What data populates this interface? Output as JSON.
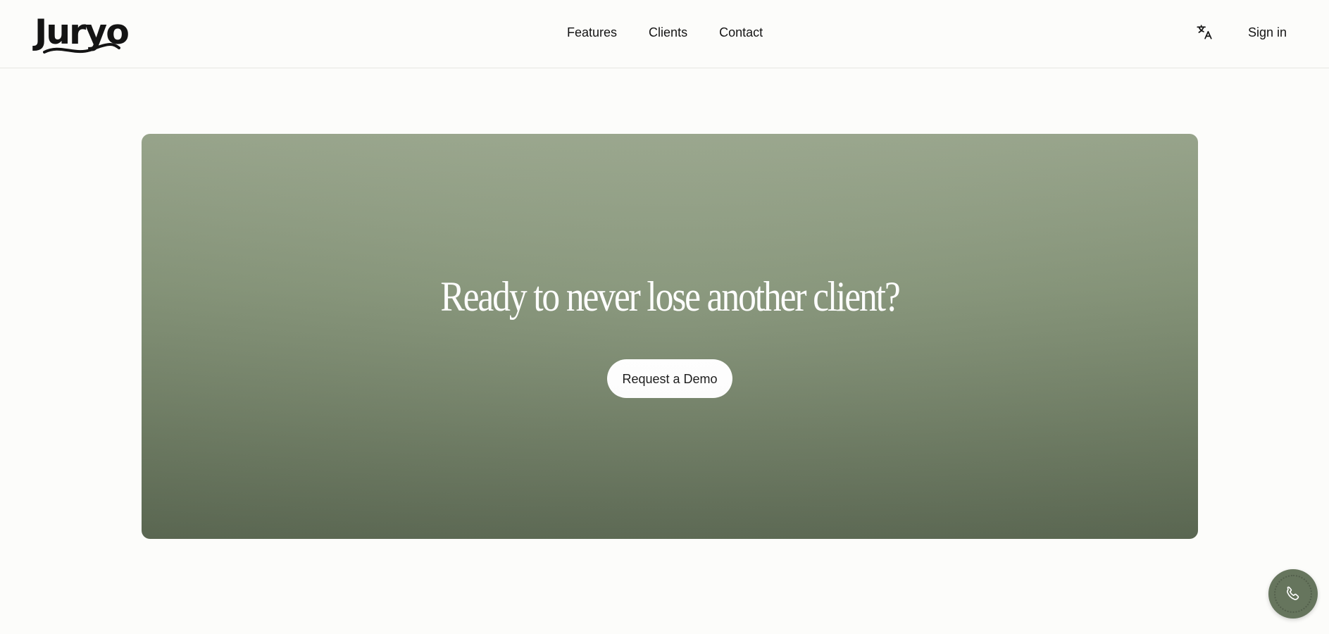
{
  "brand": {
    "logo_text": "Juryo"
  },
  "nav": {
    "items": [
      {
        "label": "Features"
      },
      {
        "label": "Clients"
      },
      {
        "label": "Contact"
      }
    ]
  },
  "header": {
    "language_icon": "translate-icon",
    "signin_label": "Sign in"
  },
  "cta": {
    "title": "Ready to never lose another client?",
    "button_label": "Request a Demo"
  },
  "fab": {
    "icon": "phone-icon"
  },
  "colors": {
    "accent_green": "#66755d",
    "card_top": "#9ca98f",
    "card_bottom": "#5d6a54",
    "background": "#fcfcfa"
  }
}
